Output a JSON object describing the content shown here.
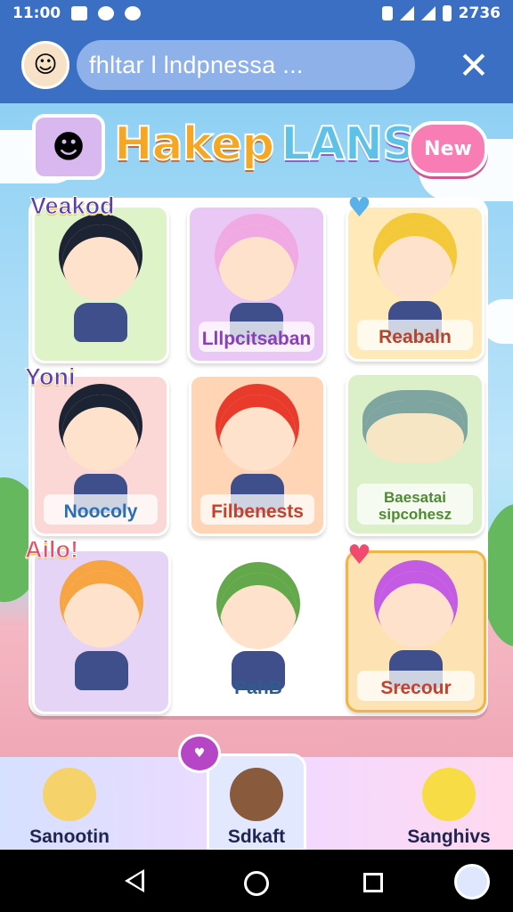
{
  "status_bar": {
    "time": "11:00",
    "battery_text": "2736"
  },
  "app_bar": {
    "search_text": "fhltar l lndpnessa ...",
    "close_glyph": "✕"
  },
  "header": {
    "title_word1": "Hakep",
    "title_word2": "LANS",
    "new_button_label": "New"
  },
  "tags": {
    "tag1": "Veakod",
    "tag2": "Yoni",
    "tag3": "Ailo!"
  },
  "grid": {
    "cards": [
      {
        "name": "",
        "bg": "#dff3c9",
        "hair": "#1c2434",
        "face": "#ffe2cc"
      },
      {
        "name": "Lllpcitsaban",
        "bg": "#e9c8f5",
        "hair": "#f1a9e3",
        "face": "#ffe2cc"
      },
      {
        "name": "Reabaln",
        "bg": "#ffe9b8",
        "hair": "#f3c93a",
        "face": "#ffe2cc"
      },
      {
        "name": "Noocoly",
        "bg": "#fbd7d5",
        "hair": "#1c2434",
        "face": "#ffe2cc"
      },
      {
        "name": "Filbenests",
        "bg": "#ffd5b5",
        "hair": "#e83b2b",
        "face": "#ffe2cc"
      },
      {
        "name": "Baesatai sipcohesz",
        "bg": "#dbefc9",
        "hair": "#7fa5a0",
        "face": "#f7e6c4"
      },
      {
        "name": "",
        "bg": "#e6d4f7",
        "hair": "#f7a543",
        "face": "#ffe2cc"
      },
      {
        "name": "PahB",
        "bg": "#ffffff",
        "hair": "#63a84b",
        "face": "#ffe2cc"
      },
      {
        "name": "Srecour",
        "bg": "#fde3b3",
        "hair": "#c45be3",
        "face": "#ffe2cc"
      }
    ]
  },
  "bottom_strip": {
    "items": [
      {
        "label": "Sanootin"
      },
      {
        "label": "Sdkaft"
      },
      {
        "label": "Sanghivs"
      }
    ]
  },
  "colors": {
    "primary": "#3b6fc3",
    "accent": "#f77db4"
  }
}
